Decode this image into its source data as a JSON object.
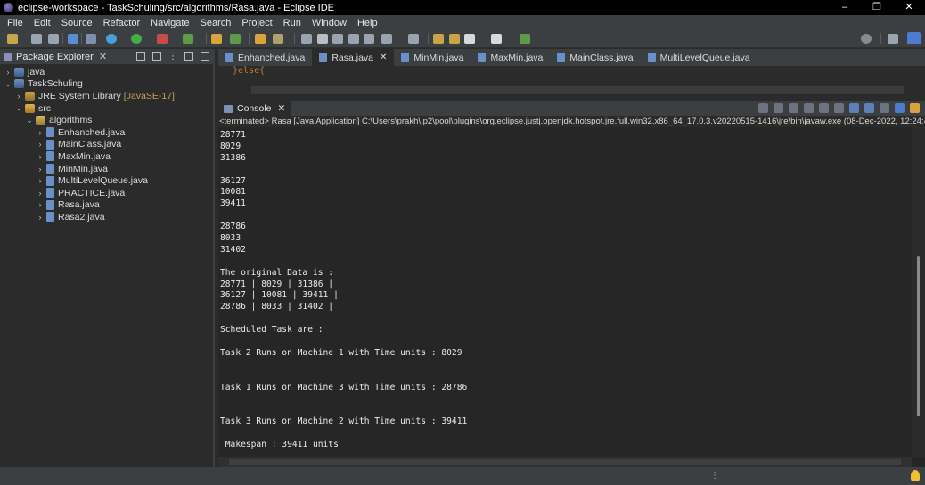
{
  "window": {
    "title": "eclipse-workspace - TaskSchuling/src/algorithms/Rasa.java - Eclipse IDE",
    "buttons": [
      "–",
      "❐",
      "✕"
    ]
  },
  "menu": [
    "File",
    "Edit",
    "Source",
    "Refactor",
    "Navigate",
    "Search",
    "Project",
    "Run",
    "Window",
    "Help"
  ],
  "package_explorer": {
    "title": "Package Explorer",
    "tree": {
      "java": "java",
      "project": "TaskSchuling",
      "jre": "JRE System Library",
      "jre_extra": "[JavaSE-17]",
      "src": "src",
      "package": "algorithms",
      "files": [
        "Enhanched.java",
        "MainClass.java",
        "MaxMin.java",
        "MinMin.java",
        "MultiLevelQueue.java",
        "PRACTICE.java",
        "Rasa.java",
        "Rasa2.java"
      ]
    }
  },
  "editor": {
    "tabs": [
      "Enhanched.java",
      "Rasa.java",
      "MinMin.java",
      "MaxMin.java",
      "MainClass.java",
      "MultiLevelQueue.java"
    ],
    "active_tab": "Rasa.java",
    "code_fragment": "}else{"
  },
  "console": {
    "title": "Console",
    "terminated": "<terminated> Rasa [Java Application] C:\\Users\\prakh\\.p2\\pool\\plugins\\org.eclipse.justj.openjdk.hotspot.jre.full.win32.x86_64_17.0.3.v20220515-1416\\jre\\bin\\javaw.exe  (08-Dec-2022, 12:24:42 am – 1",
    "output": [
      "28771",
      "8029",
      "31386",
      "",
      "36127",
      "10081",
      "39411",
      "",
      "28786",
      "8033",
      "31402",
      "",
      "The original Data is :",
      "28771 | 8029 | 31386 |",
      "36127 | 10081 | 39411 |",
      "28786 | 8033 | 31402 |",
      "",
      "Scheduled Task are :",
      "",
      "Task 2 Runs on Machine 1 with Time units : 8029",
      "",
      "",
      "Task 1 Runs on Machine 3 with Time units : 28786",
      "",
      "",
      "Task 3 Runs on Machine 2 with Time units : 39411",
      "",
      " Makespan : 39411 units"
    ]
  }
}
